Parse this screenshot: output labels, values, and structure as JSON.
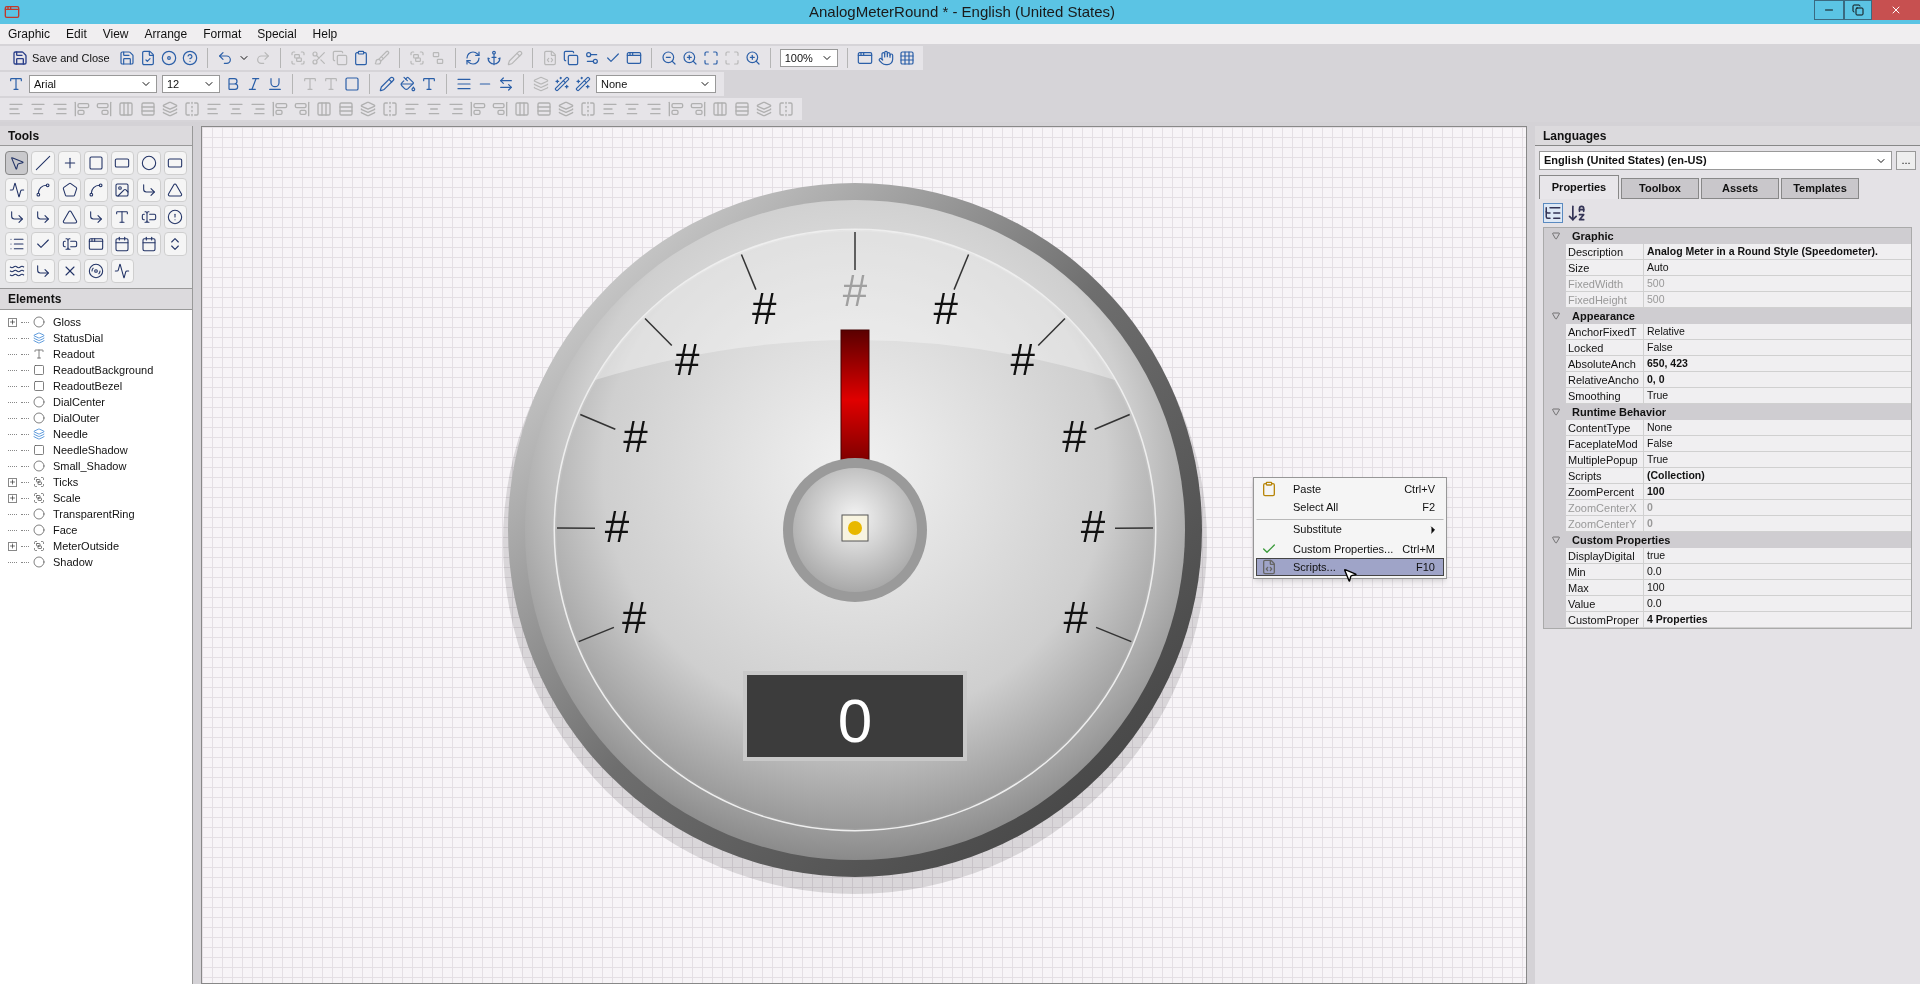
{
  "window": {
    "title": "AnalogMeterRound * - English (United States)"
  },
  "menu_bar": [
    "Graphic",
    "Edit",
    "View",
    "Arrange",
    "Format",
    "Special",
    "Help"
  ],
  "toolbar": {
    "save_close": "Save and Close",
    "zoom": "100%",
    "font": "Arial",
    "font_size": "12",
    "style_select": "None"
  },
  "tools": {
    "title": "Tools",
    "items": [
      {
        "kind": "pointer",
        "selected": true
      },
      {
        "kind": "line",
        "selected": false
      },
      {
        "kind": "cross",
        "selected": false
      },
      {
        "kind": "rect",
        "selected": false
      },
      {
        "kind": "rounded",
        "selected": false
      },
      {
        "kind": "ellipse",
        "selected": false
      },
      {
        "kind": "button",
        "selected": false
      },
      {
        "kind": "polyline",
        "selected": false
      },
      {
        "kind": "curve",
        "selected": false
      },
      {
        "kind": "polygon",
        "selected": false
      },
      {
        "kind": "blob",
        "selected": false
      },
      {
        "kind": "image",
        "selected": false
      },
      {
        "kind": "arc",
        "selected": false
      },
      {
        "kind": "pie",
        "selected": false
      },
      {
        "kind": "arc",
        "selected": false
      },
      {
        "kind": "arc",
        "selected": false
      },
      {
        "kind": "pie",
        "selected": false
      },
      {
        "kind": "arc",
        "selected": false
      },
      {
        "kind": "text",
        "selected": false
      },
      {
        "kind": "textbox",
        "selected": false
      },
      {
        "kind": "alarm",
        "selected": false
      },
      {
        "kind": "list",
        "selected": false
      },
      {
        "kind": "check",
        "selected": false
      },
      {
        "kind": "input",
        "selected": false
      },
      {
        "kind": "window",
        "selected": false
      },
      {
        "kind": "calendar",
        "selected": false
      },
      {
        "kind": "calendar",
        "selected": false
      },
      {
        "kind": "spin",
        "selected": false
      },
      {
        "kind": "trend",
        "selected": false
      },
      {
        "kind": "connector",
        "selected": false
      },
      {
        "kind": "x",
        "selected": false
      },
      {
        "kind": "media",
        "selected": false
      },
      {
        "kind": "wave",
        "selected": false
      }
    ]
  },
  "elements": {
    "title": "Elements",
    "items": [
      {
        "name": "Gloss",
        "kind": "ellipse",
        "has_children": true,
        "expanded": false
      },
      {
        "name": "StatusDial",
        "kind": "symbol",
        "has_children": false
      },
      {
        "name": "Readout",
        "kind": "text",
        "has_children": false
      },
      {
        "name": "ReadoutBackground",
        "kind": "rect",
        "has_children": false
      },
      {
        "name": "ReadoutBezel",
        "kind": "rect",
        "has_children": false
      },
      {
        "name": "DialCenter",
        "kind": "ellipse",
        "has_children": false
      },
      {
        "name": "DialOuter",
        "kind": "ellipse",
        "has_children": false
      },
      {
        "name": "Needle",
        "kind": "symbol",
        "has_children": false
      },
      {
        "name": "NeedleShadow",
        "kind": "rect",
        "has_children": false
      },
      {
        "name": "Small_Shadow",
        "kind": "ellipse",
        "has_children": false
      },
      {
        "name": "Ticks",
        "kind": "group",
        "has_children": true,
        "expanded": false
      },
      {
        "name": "Scale",
        "kind": "group",
        "has_children": true,
        "expanded": false
      },
      {
        "name": "TransparentRing",
        "kind": "ellipse",
        "has_children": false
      },
      {
        "name": "Face",
        "kind": "ellipse",
        "has_children": false
      },
      {
        "name": "MeterOutside",
        "kind": "group",
        "has_children": true,
        "expanded": false
      },
      {
        "name": "Shadow",
        "kind": "ellipse",
        "has_children": false
      }
    ]
  },
  "meter": {
    "scale_labels": [
      {
        "text": "#",
        "faded": false
      },
      {
        "text": "#",
        "faded": false
      },
      {
        "text": "#",
        "faded": false
      },
      {
        "text": "#",
        "faded": false
      },
      {
        "text": "#",
        "faded": false
      },
      {
        "text": "#",
        "faded": true
      },
      {
        "text": "#",
        "faded": false
      },
      {
        "text": "#",
        "faded": false
      },
      {
        "text": "#",
        "faded": false
      },
      {
        "text": "#",
        "faded": false
      },
      {
        "text": "#",
        "faded": false
      }
    ],
    "readout": "0"
  },
  "context_menu": [
    {
      "label": "Paste",
      "shortcut": "Ctrl+V",
      "kind": "paste",
      "selected": false,
      "separator_before": false,
      "submenu": false
    },
    {
      "label": "Select All",
      "shortcut": "F2",
      "kind": "plain",
      "selected": false,
      "separator_before": false,
      "submenu": false
    },
    {
      "label": "Substitute",
      "kind": "plain",
      "selected": false,
      "separator_before": true,
      "submenu": true
    },
    {
      "label": "Custom Properties...",
      "shortcut": "Ctrl+M",
      "kind": "check",
      "selected": false,
      "separator_before": false,
      "submenu": false
    },
    {
      "label": "Scripts...",
      "shortcut": "F10",
      "kind": "script",
      "selected": true,
      "separator_before": false,
      "submenu": false
    }
  ],
  "right_panel": {
    "languages_title": "Languages",
    "language": "English (United States) (en-US)",
    "more_button": "...",
    "tabs": [
      {
        "label": "Properties",
        "selected": true
      },
      {
        "label": "Toolbox",
        "selected": false
      },
      {
        "label": "Assets",
        "selected": false
      },
      {
        "label": "Templates",
        "selected": false
      }
    ],
    "groups": [
      {
        "title": "Graphic",
        "rows": [
          {
            "name": "Description",
            "value": "Analog Meter in a Round Style (Speedometer).",
            "bold": true,
            "disabled": false
          },
          {
            "name": "Size",
            "value": "Auto",
            "bold": false,
            "disabled": false
          },
          {
            "name": "FixedWidth",
            "value": "500",
            "bold": false,
            "disabled": true
          },
          {
            "name": "FixedHeight",
            "value": "500",
            "bold": false,
            "disabled": true
          }
        ]
      },
      {
        "title": "Appearance",
        "rows": [
          {
            "name": "AnchorFixedT",
            "value": "Relative",
            "bold": false,
            "disabled": false
          },
          {
            "name": "Locked",
            "value": "False",
            "bold": false,
            "disabled": false
          },
          {
            "name": "AbsoluteAnch",
            "value": "650, 423",
            "bold": true,
            "disabled": false
          },
          {
            "name": "RelativeAncho",
            "value": "0, 0",
            "bold": true,
            "disabled": false
          },
          {
            "name": "Smoothing",
            "value": "True",
            "bold": false,
            "disabled": false
          }
        ]
      },
      {
        "title": "Runtime Behavior",
        "rows": [
          {
            "name": "ContentType",
            "value": "None",
            "bold": false,
            "disabled": false
          },
          {
            "name": "FaceplateMod",
            "value": "False",
            "bold": false,
            "disabled": false
          },
          {
            "name": "MultiplePopup",
            "value": "True",
            "bold": false,
            "disabled": false
          },
          {
            "name": "Scripts",
            "value": "(Collection)",
            "bold": true,
            "disabled": false
          },
          {
            "name": "ZoomPercent",
            "value": "100",
            "bold": true,
            "disabled": false
          },
          {
            "name": "ZoomCenterX",
            "value": "0",
            "bold": true,
            "disabled": true
          },
          {
            "name": "ZoomCenterY",
            "value": "0",
            "bold": true,
            "disabled": true
          }
        ]
      },
      {
        "title": "Custom Properties",
        "rows": [
          {
            "name": "DisplayDigital",
            "value": "true",
            "bold": false,
            "disabled": false
          },
          {
            "name": "Min",
            "value": "0.0",
            "bold": false,
            "disabled": false
          },
          {
            "name": "Max",
            "value": "100",
            "bold": false,
            "disabled": false
          },
          {
            "name": "Value",
            "value": "0.0",
            "bold": false,
            "disabled": false
          },
          {
            "name": "CustomProper",
            "value": "4 Properties",
            "bold": true,
            "disabled": false
          }
        ]
      }
    ]
  }
}
